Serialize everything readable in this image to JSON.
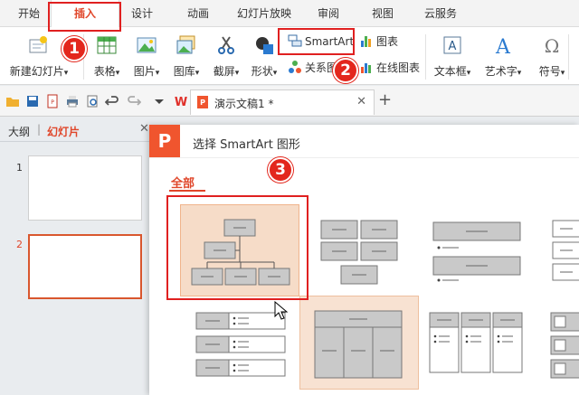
{
  "tabs": [
    {
      "label": "开始",
      "active": false
    },
    {
      "label": "插入",
      "active": true
    },
    {
      "label": "设计",
      "active": false
    },
    {
      "label": "动画",
      "active": false
    },
    {
      "label": "幻灯片放映",
      "active": false
    },
    {
      "label": "审阅",
      "active": false
    },
    {
      "label": "视图",
      "active": false
    },
    {
      "label": "云服务",
      "active": false
    }
  ],
  "ribbon": {
    "new_slide": "新建幻灯片",
    "table": "表格",
    "picture": "图片",
    "gallery": "图库",
    "screenshot": "截屏",
    "shapes": "形状",
    "relation": "关系图",
    "smartart": "SmartArt",
    "chart": "图表",
    "online_chart": "在线图表",
    "textbox": "文本框",
    "wordart": "艺术字",
    "symbol": "符号",
    "dropdown_glyph": "▾"
  },
  "quickbar": {
    "doc_tab_name": "演示文稿1 *",
    "doc_close_glyph": "✕",
    "add_tab_glyph": "+"
  },
  "left_panel": {
    "tab_outline": "大纲",
    "tab_slides": "幻灯片",
    "close_glyph": "✕",
    "slides": [
      {
        "number": "1",
        "selected": false
      },
      {
        "number": "2",
        "selected": true
      }
    ]
  },
  "dialog": {
    "logo_glyph": "P",
    "title": "选择 SmartArt 图形",
    "category": "全部"
  },
  "annotations": {
    "step1": "1",
    "step2": "2",
    "step3": "3"
  },
  "colors": {
    "accent": "#e0462a",
    "annotation_red": "#e02020",
    "selection_fill": "#f6dcc8",
    "logo_orange": "#f0552e"
  }
}
